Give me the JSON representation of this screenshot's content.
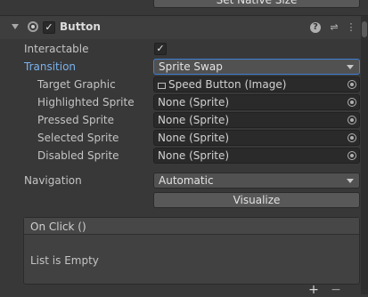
{
  "top_button": {
    "label": "Set Native Size"
  },
  "header": {
    "title": "Button",
    "enabled": true
  },
  "properties": {
    "interactable": {
      "label": "Interactable",
      "checked": true
    },
    "transition": {
      "label": "Transition",
      "value": "Sprite Swap"
    },
    "target_graphic": {
      "label": "Target Graphic",
      "value": "Speed Button (Image)"
    },
    "highlighted_sprite": {
      "label": "Highlighted Sprite",
      "value": "None (Sprite)"
    },
    "pressed_sprite": {
      "label": "Pressed Sprite",
      "value": "None (Sprite)"
    },
    "selected_sprite": {
      "label": "Selected Sprite",
      "value": "None (Sprite)"
    },
    "disabled_sprite": {
      "label": "Disabled Sprite",
      "value": "None (Sprite)"
    },
    "navigation": {
      "label": "Navigation",
      "value": "Automatic"
    },
    "visualize": {
      "label": "Visualize"
    }
  },
  "on_click": {
    "title": "On Click ()",
    "empty_text": "List is Empty",
    "add": "+",
    "remove": "−"
  },
  "colors": {
    "background": "#383838",
    "active_label": "#7ab2ee",
    "focus_border": "#3d7fd4"
  }
}
